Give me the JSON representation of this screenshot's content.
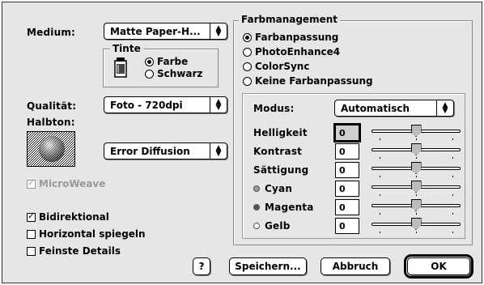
{
  "left": {
    "medium_label": "Medium:",
    "medium_value": "Matte Paper-H...",
    "tinte": {
      "title": "Tinte",
      "options": [
        {
          "label": "Farbe",
          "selected": true
        },
        {
          "label": "Schwarz",
          "selected": false
        }
      ]
    },
    "qualitaet_label": "Qualität:",
    "qualitaet_value": "Foto - 720dpi",
    "halbton_label": "Halbton:",
    "halbton_value": "Error Diffusion",
    "microweave_label": "MicroWeave",
    "microweave_checked": true,
    "microweave_disabled": true,
    "checks": [
      {
        "label": "Bidirektional",
        "checked": true
      },
      {
        "label": "Horizontal spiegeln",
        "checked": false
      },
      {
        "label": "Feinste Details",
        "checked": false
      }
    ]
  },
  "farb": {
    "title": "Farbmanagement",
    "options": [
      {
        "label": "Farbanpassung",
        "selected": true
      },
      {
        "label": "PhotoEnhance4",
        "selected": false
      },
      {
        "label": "ColorSync",
        "selected": false
      },
      {
        "label": "Keine Farbanpassung",
        "selected": false
      }
    ],
    "modus_label": "Modus:",
    "modus_value": "Automatisch",
    "sliders": [
      {
        "label": "Helligkeit",
        "value": "0",
        "dot": "",
        "level": 0.5
      },
      {
        "label": "Kontrast",
        "value": "0",
        "dot": "",
        "level": 0.5
      },
      {
        "label": "Sättigung",
        "value": "0",
        "dot": "",
        "level": 0.5
      },
      {
        "label": "Cyan",
        "value": "0",
        "dot": "#999999",
        "level": 0.5
      },
      {
        "label": "Magenta",
        "value": "0",
        "dot": "#555555",
        "level": 0.5
      },
      {
        "label": "Gelb",
        "value": "0",
        "dot": "#ffffff",
        "level": 0.5
      }
    ]
  },
  "buttons": {
    "help": "?",
    "save": "Speichern...",
    "cancel": "Abbruch",
    "ok": "OK"
  }
}
